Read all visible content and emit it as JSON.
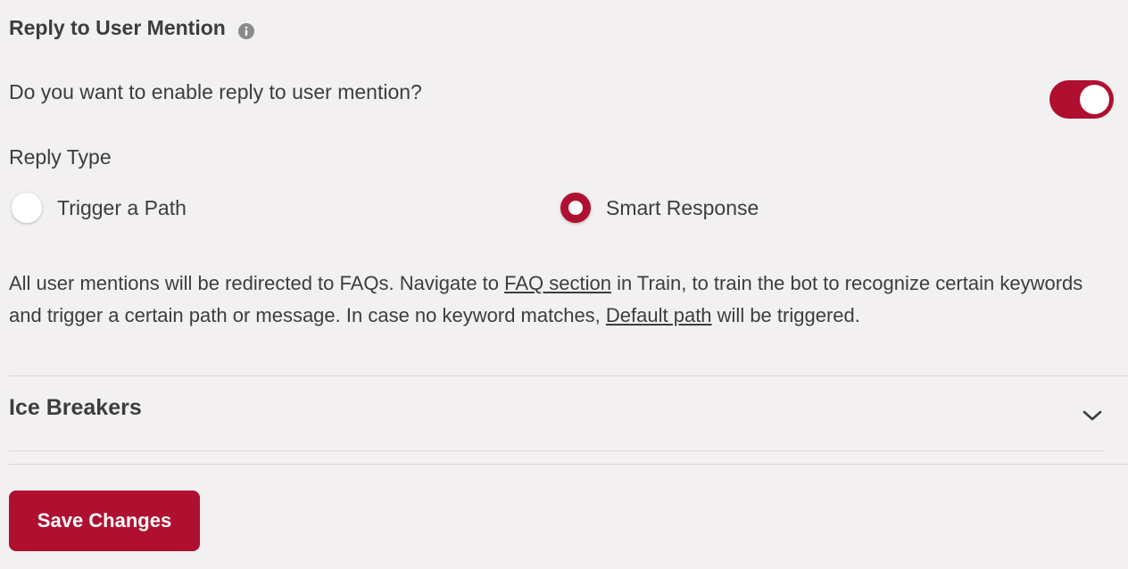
{
  "reply_to_mention": {
    "title": "Reply to User Mention",
    "info_icon": "info-icon",
    "question": "Do you want to enable reply to user mention?",
    "toggle_enabled": true,
    "reply_type_label": "Reply Type",
    "options": [
      {
        "label": "Trigger a Path",
        "selected": false
      },
      {
        "label": "Smart Response",
        "selected": true
      }
    ],
    "description": {
      "part1": "All user mentions will be redirected to FAQs. Navigate to ",
      "link1": "FAQ section",
      "part2": " in Train, to train the bot to recognize certain keywords and trigger a certain path or message. In case no keyword matches, ",
      "link2": "Default path",
      "part3": " will be triggered."
    }
  },
  "ice_breakers": {
    "title": "Ice Breakers",
    "expand_icon": "chevron-down-icon"
  },
  "actions": {
    "save_label": "Save Changes"
  },
  "colors": {
    "accent": "#b01030",
    "background": "#f2f0f0",
    "text": "#3d3d3d"
  }
}
